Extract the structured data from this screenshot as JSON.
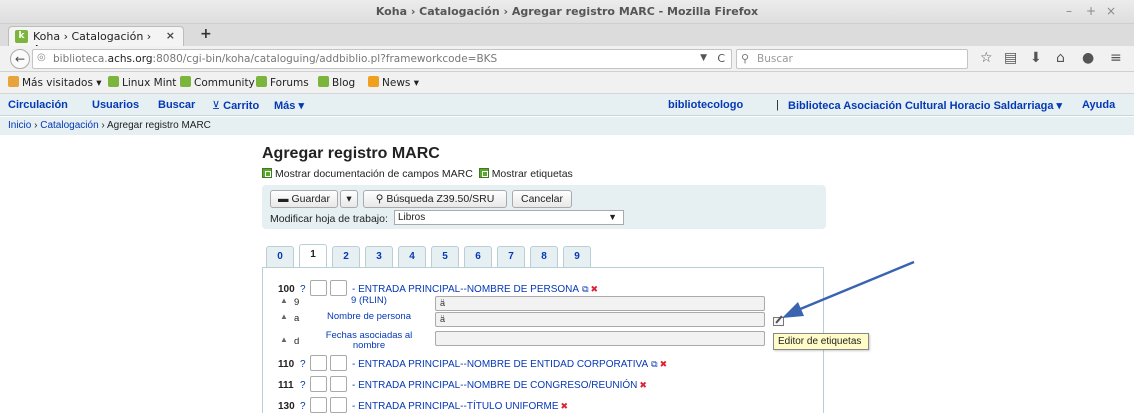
{
  "window": {
    "title": "Koha › Catalogación › Agregar registro MARC - Mozilla Firefox",
    "controls": [
      "–",
      "+",
      "×"
    ]
  },
  "browser": {
    "tab_label": "Koha › Catalogación › Agr...",
    "tab_close": "×",
    "new_tab": "+",
    "url_prefix": "biblioteca.",
    "url_domain": "achs.org",
    "url_rest": ":8080/cgi-bin/koha/cataloguing/addbiblio.pl?frameworkcode=BKS",
    "search_placeholder": "Buscar",
    "bookmarks": [
      {
        "label": "Más visitados ▾",
        "icon_color": "#e8a33a"
      },
      {
        "label": "Linux Mint",
        "icon_color": "#7bb53b"
      },
      {
        "label": "Community",
        "icon_color": "#7bb53b"
      },
      {
        "label": "Forums",
        "icon_color": "#7bb53b"
      },
      {
        "label": "Blog",
        "icon_color": "#7bb53b"
      },
      {
        "label": "News ▾",
        "icon_color": "#f0a020"
      }
    ]
  },
  "koha_nav": {
    "left": [
      "Circulación",
      "Usuarios",
      "Buscar",
      "Carrito",
      "Más ▾"
    ],
    "cart_icon": "cart-icon",
    "user": "bibliotecologo",
    "separator": "|",
    "library": "Biblioteca Asociación Cultural Horacio Saldarriaga ▾",
    "help": "Ayuda"
  },
  "breadcrumbs": {
    "home": "Inicio",
    "sep": " › ",
    "section": "Catalogación",
    "current": "Agregar registro MARC"
  },
  "page": {
    "heading": "Agregar registro MARC",
    "toggle_docs": "Mostrar documentación de campos MARC",
    "toggle_tags": "Mostrar etiquetas",
    "save_label": "Guardar",
    "search_label": "Búsqueda Z39.50/SRU",
    "cancel_label": "Cancelar",
    "framework_label": "Modificar hoja de trabajo:",
    "framework_value": "Libros"
  },
  "tabs": [
    "0",
    "1",
    "2",
    "3",
    "4",
    "5",
    "6",
    "7",
    "8",
    "9"
  ],
  "active_tab": "1",
  "fields": [
    {
      "tag": "100",
      "desc": "- ENTRADA PRINCIPAL--NOMBRE DE PERSONA"
    },
    {
      "tag": "110",
      "desc": "- ENTRADA PRINCIPAL--NOMBRE DE ENTIDAD CORPORATIVA"
    },
    {
      "tag": "111",
      "desc": "- ENTRADA PRINCIPAL--NOMBRE DE CONGRESO/REUNIÓN"
    },
    {
      "tag": "130",
      "desc": "- ENTRADA PRINCIPAL--TÍTULO UNIFORME"
    }
  ],
  "field_help": "?",
  "subfields": [
    {
      "code": "9",
      "label": "9 (RLIN)",
      "value": "ä"
    },
    {
      "code": "a",
      "label": "Nombre de persona",
      "value": "ä"
    },
    {
      "code": "d",
      "label": "Fechas asociadas al nombre",
      "value": ""
    }
  ],
  "tooltip": "Editor de etiquetas",
  "annotation_arrow_color": "#3a64b0"
}
